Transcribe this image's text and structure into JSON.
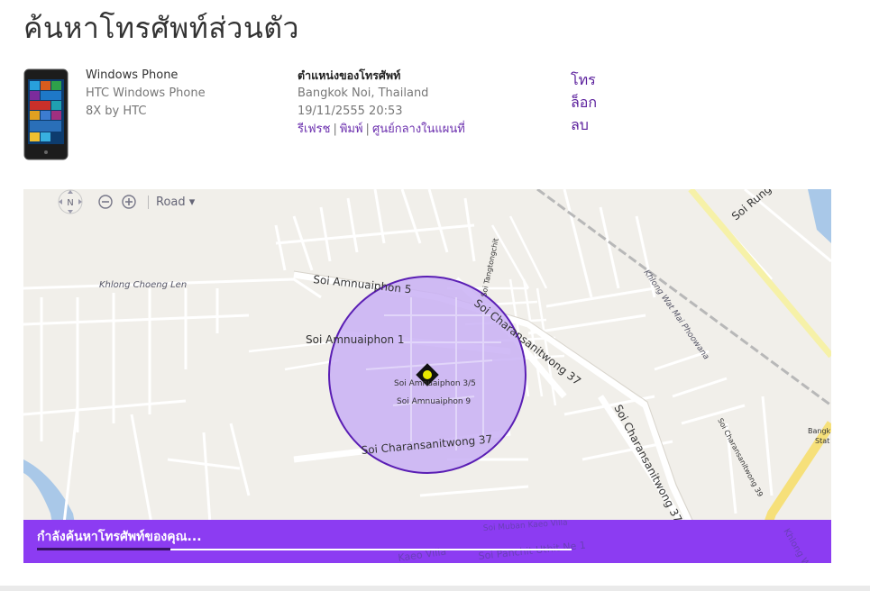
{
  "page": {
    "title": "ค้นหาโทรศัพท์ส่วนตัว"
  },
  "device": {
    "name": "Windows Phone",
    "model": "HTC Windows Phone",
    "variant": "8X by HTC",
    "image": "phone-icon"
  },
  "location": {
    "heading": "ตำแหน่งของโทรศัพท์",
    "place": "Bangkok Noi, Thailand",
    "timestamp": "19/11/2555 20:53",
    "links": {
      "refresh": "รีเฟรช",
      "print": "พิมพ์",
      "center": "ศูนย์กลางในแผนที่",
      "separator": "|"
    }
  },
  "actions": {
    "call": "โทร",
    "lock": "ล็อก",
    "erase": "ลบ"
  },
  "map": {
    "compass_label": "N",
    "zoom_out_icon": "minus-icon",
    "zoom_in_icon": "plus-icon",
    "map_type": "Road",
    "labels": {
      "khlong_choeng_len": "Khlong Choeng Len",
      "soi_amnuaiphon_5": "Soi Amnuaiphon 5",
      "soi_amnuaiphon_1": "Soi Amnuaiphon 1",
      "soi_amnuaiphon_3_5": "Soi Amnuaiphon 3/5",
      "soi_amnuaiphon_9": "Soi Amnuaiphon 9",
      "soi_charansanitwong_37_a": "Soi Charansanitwong 37",
      "soi_charansanitwong_37_b": "Soi Charansanitwong 37",
      "soi_charansanitwong_37_c": "Soi Charansanitwong 37",
      "soi_charansanitwong_39": "Soi Charansanitwong 39",
      "soi_tangtongchit": "Soi Tangtongchit",
      "khlong_wat_mai_phoowana": "Khlong Wat Mai Phoowana",
      "soi_rung": "Soi Rung",
      "bangkok_stat": "Bangk",
      "bangkok_stat2": "Stat",
      "soi_muban_kaeo_villa": "Soi Muban Kaeo Villa",
      "soi_panchit_uthit": "Soi Panchit Uthit Ne 1",
      "kaeo_villa": "Kaeo Villa",
      "khlong_bottom": "Khlong Wa"
    },
    "colors": {
      "circle_fill": "#c9b0f5",
      "circle_stroke": "#5a1eb4",
      "marker": "#e8e800"
    }
  },
  "status": {
    "text": "กำลังค้นหาโทรศัพท์ของคุณ...",
    "progress": 0.25,
    "bar_color": "#8c3cf2"
  }
}
